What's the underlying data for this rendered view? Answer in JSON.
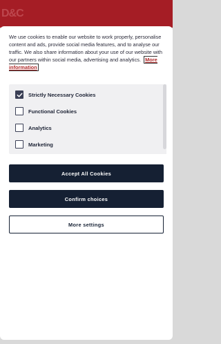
{
  "brand": {
    "logo_text": "D&C"
  },
  "cookie_banner": {
    "description": "We use cookies to enable our website to work properly, personalise content and ads, provide social media features, and to analyse our traffic. We also share information about your use of our website with our partners within social media, advertising and analytics.",
    "more_info_label": "More information",
    "options": [
      {
        "label": "Strictly Necessary Cookies",
        "checked": true
      },
      {
        "label": "Functional Cookies",
        "checked": false
      },
      {
        "label": "Analytics",
        "checked": false
      },
      {
        "label": "Marketing",
        "checked": false
      }
    ],
    "accept_all_label": "Accept All Cookies",
    "confirm_label": "Confirm choices",
    "more_settings_label": "More settings"
  },
  "colors": {
    "brand_red": "#a51d25",
    "dark_navy": "#152033",
    "link_red": "#b02a2a"
  }
}
